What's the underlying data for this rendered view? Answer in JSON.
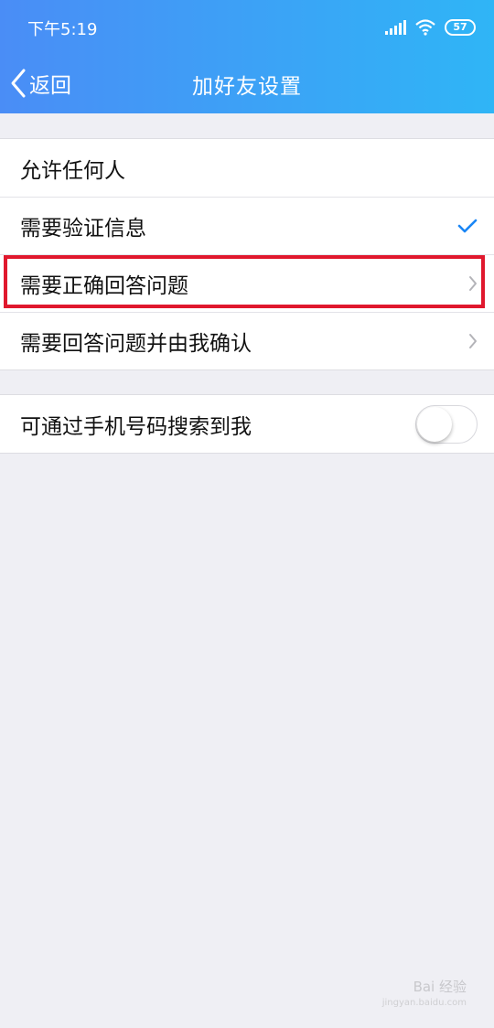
{
  "status": {
    "time": "下午5:19",
    "battery": "57"
  },
  "nav": {
    "back_label": "返回",
    "title": "加好友设置"
  },
  "group1": {
    "items": [
      {
        "label": "允许任何人"
      },
      {
        "label": "需要验证信息",
        "selected": true
      },
      {
        "label": "需要正确回答问题"
      },
      {
        "label": "需要回答问题并由我确认"
      }
    ]
  },
  "group2": {
    "items": [
      {
        "label": "可通过手机号码搜索到我",
        "toggle_on": false
      }
    ]
  },
  "colors": {
    "topbar_start": "#4a8df6",
    "topbar_end": "#2fb5f6",
    "check": "#1a86f5",
    "highlight": "#e0182d"
  },
  "watermark": {
    "text": "Bai 经验",
    "sub": "jingyan.baidu.com"
  }
}
